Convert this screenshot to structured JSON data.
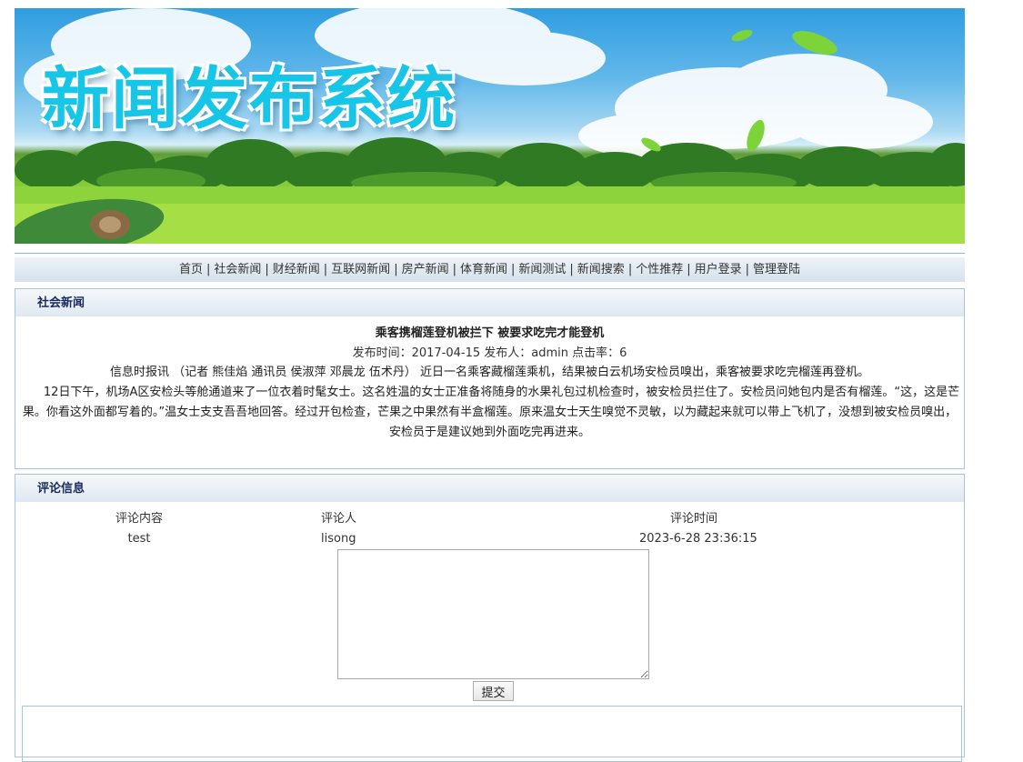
{
  "banner": {
    "title": "新闻发布系统"
  },
  "nav": {
    "items": [
      "首页",
      "社会新闻",
      "财经新闻",
      "互联网新闻",
      "房产新闻",
      "体育新闻",
      "新闻测试",
      "新闻搜索",
      "个性推荐",
      "用户登录",
      "管理登陆"
    ],
    "separator": "|"
  },
  "news": {
    "section_title": "社会新闻",
    "article_title": "乘客携榴莲登机被拦下 被要求吃完才能登机",
    "meta": "发布时间：2017-04-15 发布人：admin 点击率：6",
    "body_line1": "信息时报讯 （记者 熊佳焰 通讯员 侯淑萍 邓晨龙 伍术丹） 近日一名乘客藏榴莲乘机，结果被白云机场安检员嗅出，乘客被要求吃完榴莲再登机。",
    "body_line2": "　　12日下午，机场A区安检头等舱通道来了一位衣着时髦女士。这名姓温的女士正准备将随身的水果礼包过机检查时，被安检员拦住了。安检员问她包内是否有榴莲。“这，这是芒果。你看这外面都写着的。”温女士支支吾吾地回答。经过开包检查，芒果之中果然有半盒榴莲。原来温女士天生嗅觉不灵敏，以为藏起来就可以带上飞机了，没想到被安检员嗅出，安检员于是建议她到外面吃完再进来。"
  },
  "comments": {
    "section_title": "评论信息",
    "headers": {
      "content": "评论内容",
      "user": "评论人",
      "time": "评论时间"
    },
    "rows": [
      {
        "content": "test",
        "user": "lisong",
        "time": "2023-6-28 23:36:15"
      }
    ],
    "reply_value": "",
    "submit_label": "提交"
  }
}
